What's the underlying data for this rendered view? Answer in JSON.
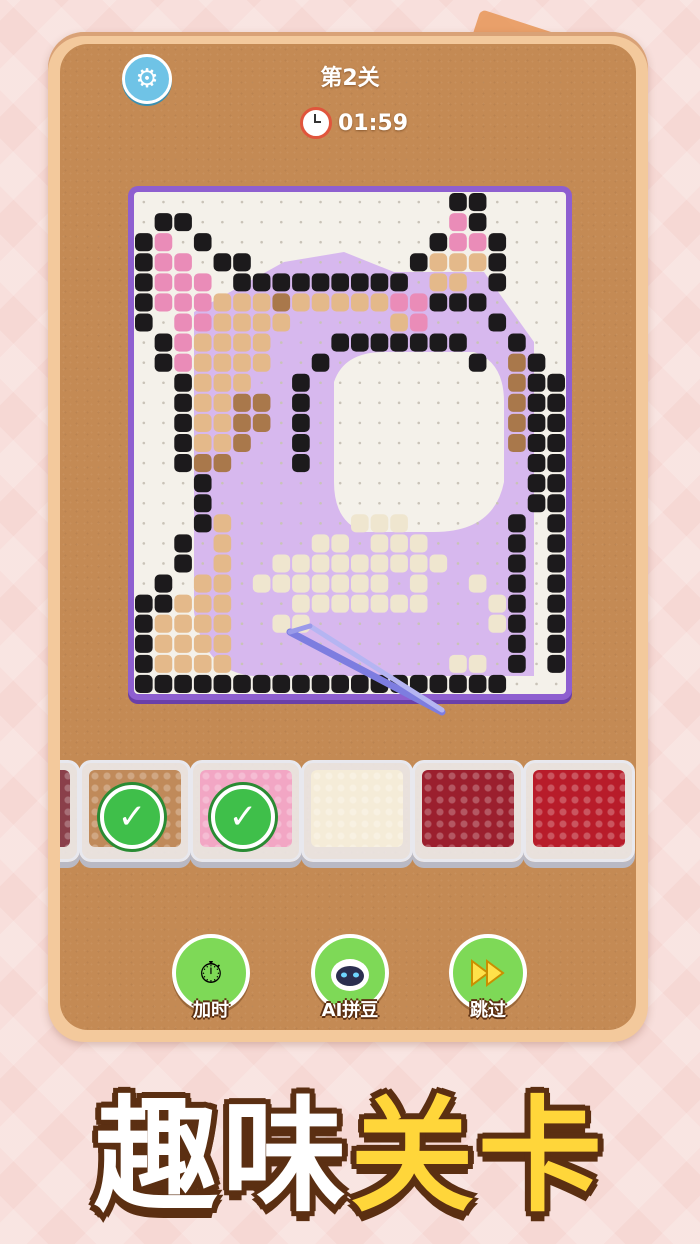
{
  "level": {
    "label": "第2关"
  },
  "timer": {
    "value": "01:59"
  },
  "actions": [
    {
      "label": "加时",
      "icon": "stopwatch-icon",
      "color": "#7ed957"
    },
    {
      "label": "AI拼豆",
      "icon": "robot-icon",
      "color": "#7ed957"
    },
    {
      "label": "跳过",
      "icon": "fast-forward-icon",
      "color": "#7ed957"
    }
  ],
  "trays": [
    {
      "color": "#8a3f4a",
      "completed": false
    },
    {
      "color": "#c08a5a",
      "completed": true
    },
    {
      "color": "#f2a6c4",
      "completed": true
    },
    {
      "color": "#f5ecd8",
      "completed": false
    },
    {
      "color": "#9b1f2e",
      "completed": false
    },
    {
      "color": "#b81c2a",
      "completed": false
    }
  ],
  "banner": {
    "white_text": "趣味",
    "yellow_text": "关卡"
  },
  "colors": {
    "board_frame": "#8e5fd0",
    "peg_white": "#f4f1ea",
    "bead_black": "#1c1a1c",
    "bead_pink": "#ea8cb8",
    "bead_tan": "#e4b98a",
    "bead_brown": "#a9784b",
    "bead_cream": "#efe6cf",
    "bead_lilac": "#d7b8ee"
  }
}
